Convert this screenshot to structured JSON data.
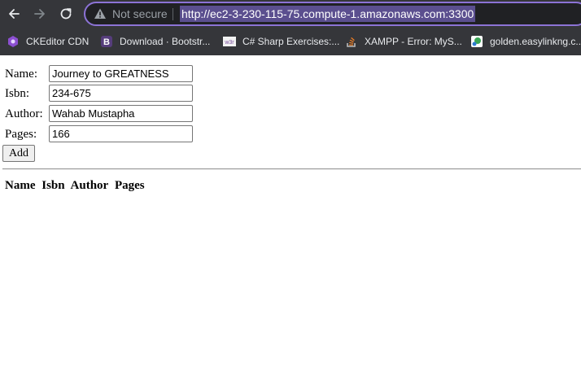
{
  "browser": {
    "security_label": "Not secure",
    "url": "http://ec2-3-230-115-75.compute-1.amazonaws.com:3300",
    "bookmarks": [
      {
        "label": "CKEditor CDN",
        "icon": "ckeditor-icon"
      },
      {
        "label": "Download · Bootstr...",
        "icon": "bootstrap-icon"
      },
      {
        "label": "C# Sharp Exercises:...",
        "icon": "w3r-icon"
      },
      {
        "label": "XAMPP - Error: MyS...",
        "icon": "stackoverflow-icon"
      },
      {
        "label": "golden.easylinkng.c...",
        "icon": "easylink-icon"
      }
    ]
  },
  "form": {
    "name_label": "Name:",
    "name_value": "Journey to GREATNESS",
    "isbn_label": "Isbn:",
    "isbn_value": "234-675",
    "author_label": "Author:",
    "author_value": "Wahab Mustapha",
    "pages_label": "Pages:",
    "pages_value": "166",
    "add_label": "Add"
  },
  "table": {
    "headers": [
      "Name",
      "Isbn",
      "Author",
      "Pages"
    ]
  },
  "colors": {
    "chrome_bg": "#35363a",
    "omnibox_bg": "#202124",
    "omnibox_border": "#8c73d6",
    "url_highlight": "#5b4f8f"
  }
}
